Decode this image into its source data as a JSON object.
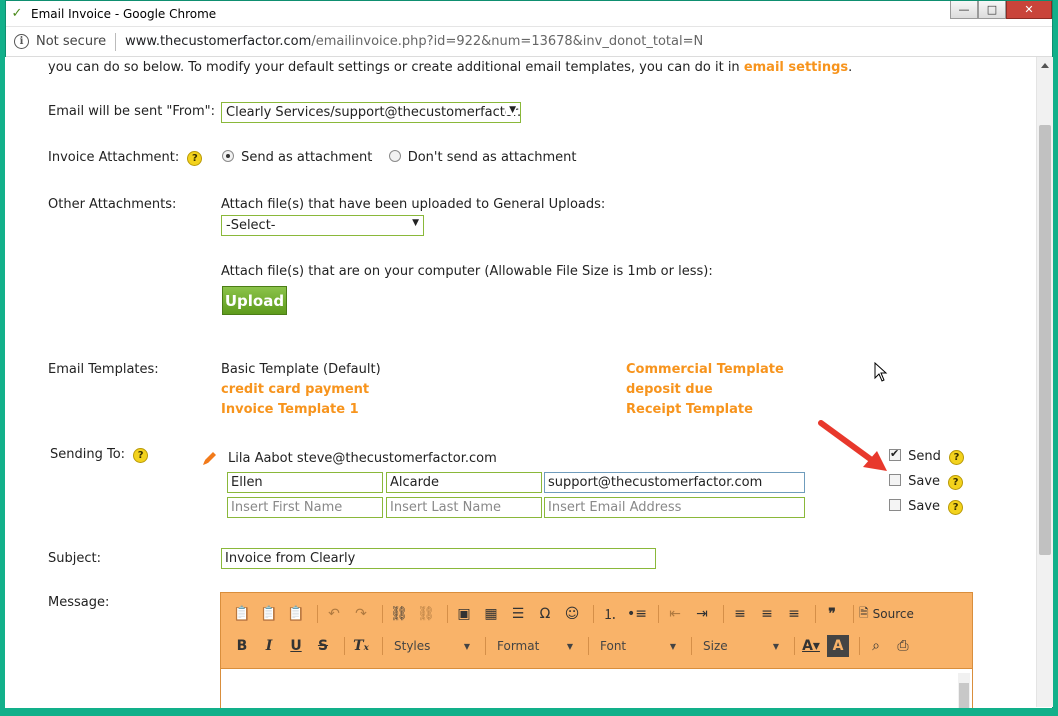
{
  "window": {
    "title": "Email Invoice - Google Chrome",
    "controls": {
      "minimize": "—",
      "maximize": "□",
      "close": "✕"
    }
  },
  "address_bar": {
    "security_label": "Not secure",
    "url_host": "www.thecustomerfactor.com",
    "url_path": "/emailinvoice.php?id=922&num=13678&inv_donot_total=N"
  },
  "intro": {
    "text": "you can do so below. To modify your default settings or create additional email templates, you can do it in ",
    "link": "email settings",
    "trailing": "."
  },
  "from": {
    "label": "Email will be sent \"From\":",
    "value": "Clearly Services/support@thecustomerfactor.c"
  },
  "invoice_attachment": {
    "label": "Invoice Attachment:",
    "options": [
      {
        "label": "Send as attachment",
        "checked": true
      },
      {
        "label": "Don't send as attachment",
        "checked": false
      }
    ]
  },
  "other_attachments": {
    "label": "Other Attachments:",
    "general_uploads_label": "Attach file(s) that have been uploaded to General Uploads:",
    "general_uploads_value": "-Select-",
    "computer_label": "Attach file(s) that are on your computer (Allowable File Size is 1mb or less):",
    "upload_button": "Upload"
  },
  "email_templates": {
    "label": "Email Templates:",
    "col1": [
      "Basic Template (Default)",
      "credit card payment",
      "Invoice Template 1"
    ],
    "col2": [
      "Commercial Template",
      "deposit due",
      "Receipt Template"
    ]
  },
  "sending_to": {
    "label": "Sending To:",
    "recipient": "Lila Aabot steve@thecustomerfactor.com",
    "row1": {
      "first": "Ellen",
      "last": "Alcarde",
      "email": "support@thecustomerfactor.com"
    },
    "placeholders": {
      "first": "Insert First Name",
      "last": "Insert Last Name",
      "email": "Insert Email Address"
    },
    "options": [
      {
        "label": "Send",
        "checked": true
      },
      {
        "label": "Save",
        "checked": false
      },
      {
        "label": "Save",
        "checked": false
      }
    ]
  },
  "subject": {
    "label": "Subject:",
    "value": "Invoice from Clearly"
  },
  "message": {
    "label": "Message:",
    "toolbar": {
      "source_label": "Source",
      "styles": "Styles",
      "format": "Format",
      "font": "Font",
      "size": "Size"
    }
  },
  "colors": {
    "accent_orange": "#f7941d",
    "field_border": "#8ab83a",
    "upload_green": "#6aa826",
    "editor_toolbar": "#f9b369"
  }
}
